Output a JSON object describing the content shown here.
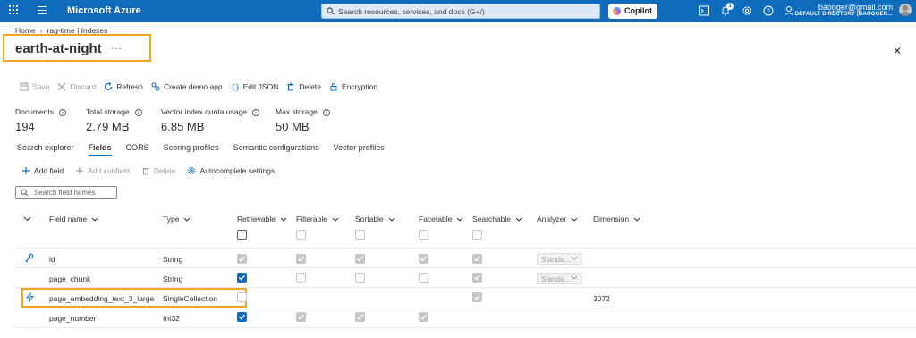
{
  "topbar": {
    "brand": "Microsoft Azure",
    "search_placeholder": "Search resources, services, and docs (G+/)",
    "copilot_label": "Copilot",
    "notification_count": "1",
    "account_email": "baogger@gmail.com",
    "account_directory": "DEFAULT DIRECTORY (BAOGGER..."
  },
  "breadcrumb": [
    "Home",
    "rag-time | Indexes"
  ],
  "page": {
    "title": "earth-at-night",
    "more": "···"
  },
  "toolbar": {
    "save": "Save",
    "discard": "Discard",
    "refresh": "Refresh",
    "create_demo_app": "Create demo app",
    "edit_json": "Edit JSON",
    "delete": "Delete",
    "encryption": "Encryption"
  },
  "stats": [
    {
      "label": "Documents",
      "value": "194"
    },
    {
      "label": "Total storage",
      "value": "2.79 MB"
    },
    {
      "label": "Vector index quota usage",
      "value": "6.85 MB"
    },
    {
      "label": "Max storage",
      "value": "50 MB"
    }
  ],
  "tabs": [
    "Search explorer",
    "Fields",
    "CORS",
    "Scoring profiles",
    "Semantic configurations",
    "Vector profiles"
  ],
  "active_tab": "Fields",
  "actions": {
    "add_field": "Add field",
    "add_subfield": "Add subfield",
    "delete": "Delete",
    "autocomplete": "Autocomplete settings"
  },
  "field_search_placeholder": "Search field names",
  "table": {
    "columns": [
      "Field name",
      "Type",
      "Retrievable",
      "Filterable",
      "Sortable",
      "Facetable",
      "Searchable",
      "Analyzer",
      "Dimension"
    ],
    "rows": [
      {
        "name": "id",
        "type": "String",
        "key": true,
        "retrievable": "disabled-checked",
        "filterable": "disabled-checked",
        "sortable": "disabled-checked",
        "facetable": "disabled-checked",
        "searchable": "disabled-checked",
        "analyzer": "Standa...",
        "dimension": ""
      },
      {
        "name": "page_chunk",
        "type": "String",
        "retrievable": "checked",
        "filterable": "unchecked",
        "sortable": "unchecked",
        "facetable": "unchecked",
        "searchable": "disabled-checked",
        "analyzer": "Standa...",
        "dimension": ""
      },
      {
        "name": "page_embedding_text_3_large",
        "type": "SingleCollection",
        "vector": true,
        "retrievable": "unchecked",
        "searchable": "disabled-checked",
        "analyzer": "",
        "dimension": "3072"
      },
      {
        "name": "page_number",
        "type": "Int32",
        "retrievable": "checked",
        "filterable": "disabled-checked",
        "sortable": "disabled-checked",
        "facetable": "disabled-checked",
        "analyzer": "",
        "dimension": ""
      }
    ]
  },
  "colors": {
    "accent": "#0f6cbd",
    "highlight": "#f4a423"
  }
}
